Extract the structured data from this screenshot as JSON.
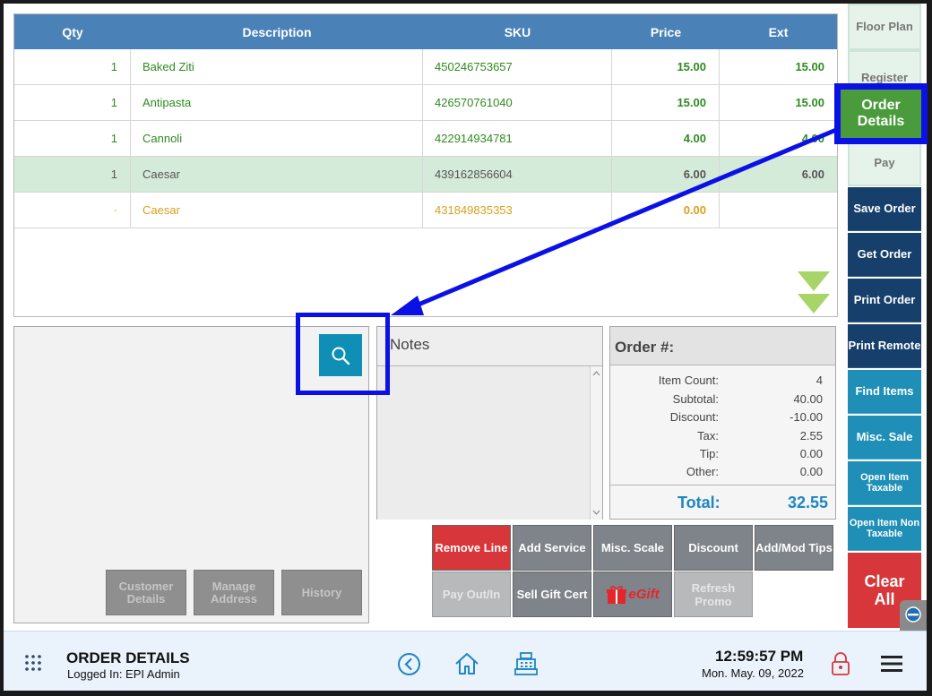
{
  "table": {
    "columns": [
      "Qty",
      "Description",
      "SKU",
      "Price",
      "Ext"
    ],
    "rows": [
      {
        "qty": "1",
        "desc": "Baked Ziti",
        "sku": "450246753657",
        "price": "15.00",
        "ext": "15.00"
      },
      {
        "qty": "1",
        "desc": "Antipasta",
        "sku": "426570761040",
        "price": "15.00",
        "ext": "15.00"
      },
      {
        "qty": "1",
        "desc": "Cannoli",
        "sku": "422914934781",
        "price": "4.00",
        "ext": "4.00"
      },
      {
        "qty": "1",
        "desc": "Caesar",
        "sku": "439162856604",
        "price": "6.00",
        "ext": "6.00"
      },
      {
        "qty": "·",
        "desc": "Caesar",
        "sku": "431849835353",
        "price": "0.00",
        "ext": ""
      }
    ]
  },
  "customer": {
    "buttons": [
      "Customer Details",
      "Manage Address",
      "History"
    ]
  },
  "notes": {
    "title": "Notes"
  },
  "order": {
    "title": "Order #:",
    "lines": [
      {
        "label": "Item Count:",
        "value": "4"
      },
      {
        "label": "Subtotal:",
        "value": "40.00"
      },
      {
        "label": "Discount:",
        "value": "-10.00"
      },
      {
        "label": "Tax:",
        "value": "2.55"
      },
      {
        "label": "Tip:",
        "value": "0.00"
      },
      {
        "label": "Other:",
        "value": "0.00"
      }
    ],
    "total_label": "Total:",
    "total_value": "32.55"
  },
  "actions": {
    "remove_line": "Remove Line",
    "add_service": "Add Service",
    "misc_scale": "Misc. Scale",
    "discount": "Discount",
    "add_mod_tips": "Add/Mod Tips",
    "pay_out_in": "Pay Out/In",
    "sell_gift_cert": "Sell Gift Cert",
    "egift": "eGift",
    "refresh_promo": "Refresh Promo"
  },
  "sidebar": {
    "floor_plan": "Floor Plan",
    "register": "Register",
    "order_details": "Order Details",
    "pay": "Pay",
    "save_order": "Save Order",
    "get_order": "Get Order",
    "print_order": "Print Order",
    "print_remote": "Print Remote",
    "find_items": "Find Items",
    "misc_sale": "Misc. Sale",
    "open_item_taxable": "Open Item Taxable",
    "open_item_non_taxable": "Open Item Non Taxable",
    "clear_all": "Clear All"
  },
  "footer": {
    "title": "ORDER DETAILS",
    "logged_in": "Logged In:  EPI Admin",
    "time": "12:59:57 PM",
    "date": "Mon. May. 09, 2022"
  },
  "colors": {
    "header_blue": "#4a82b8",
    "accent_teal": "#1f8fb7",
    "navy": "#173f6b",
    "annotation_blue": "#0a10e6",
    "order_green": "#4a9b3c",
    "clear_red": "#d7373a"
  }
}
